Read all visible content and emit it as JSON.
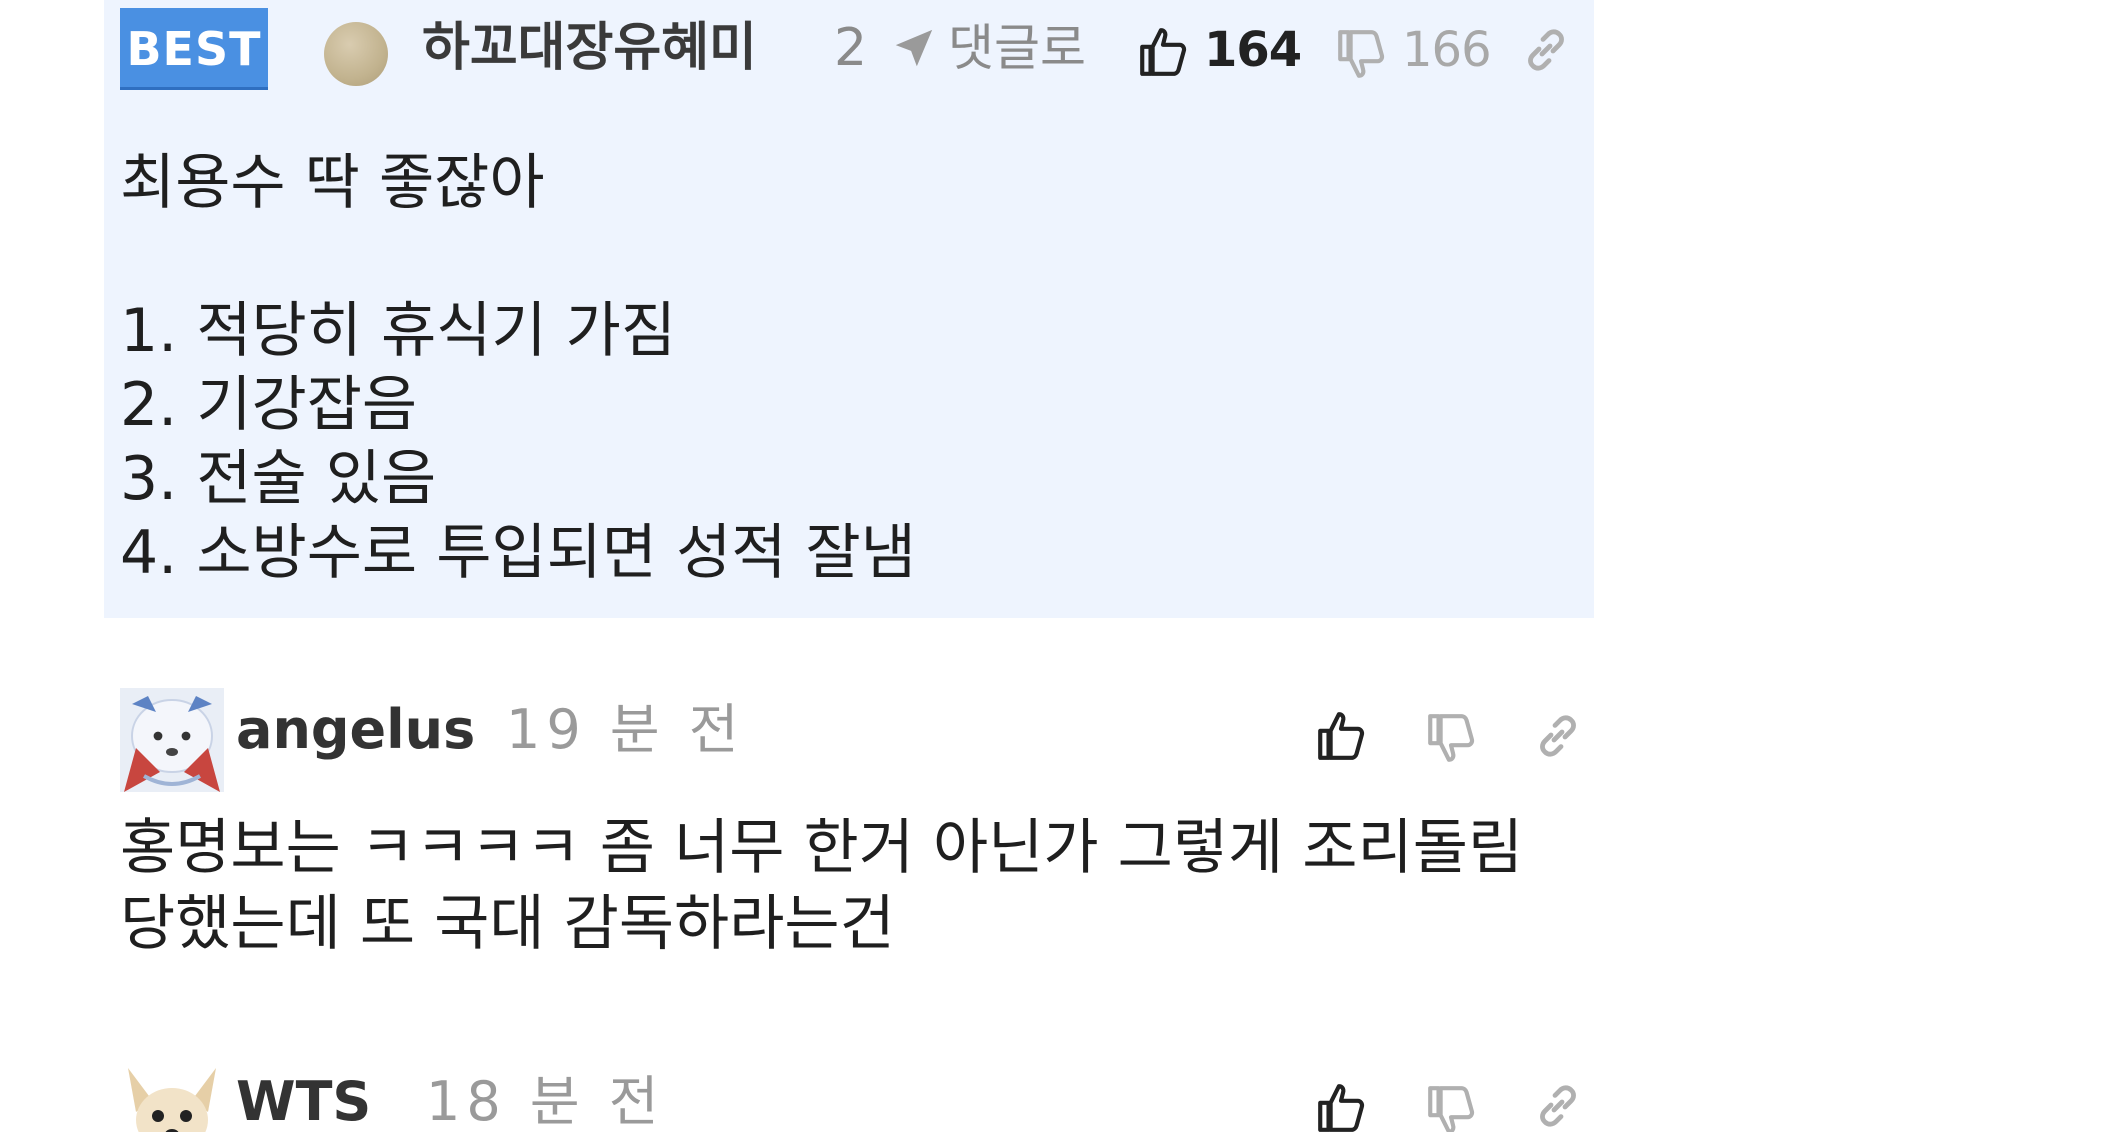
{
  "comments": {
    "best": {
      "badge": "BEST",
      "author": "하꼬대장유혜미",
      "reply_count": "2",
      "reply_label": "댓글로",
      "upvotes": "164",
      "downvotes": "166",
      "body": {
        "line1": "최용수 딱 좋잖아",
        "line2": "1. 적당히 휴식기 가짐",
        "line3": "2. 기강잡음",
        "line4": "3. 전술 있음",
        "line5": "4. 소방수로 투입되면 성적 잘냄"
      }
    },
    "items": [
      {
        "author": "angelus",
        "time": "19 분 전",
        "body": "홍명보는 ㅋㅋㅋㅋ 좀 너무 한거 아닌가 그렇게 조리돌림 당했는데 또 국대 감독하라는건"
      },
      {
        "author": "WTS",
        "time": "18 분 전"
      }
    ]
  },
  "colors": {
    "best_bg": "#eef4fe",
    "best_badge": "#4a90e2",
    "muted_text": "#9a9a9a"
  },
  "icons": {
    "upvote": "thumbs-up-icon",
    "downvote": "thumbs-down-icon",
    "reply": "reply-arrow-icon",
    "permalink": "link-icon"
  }
}
